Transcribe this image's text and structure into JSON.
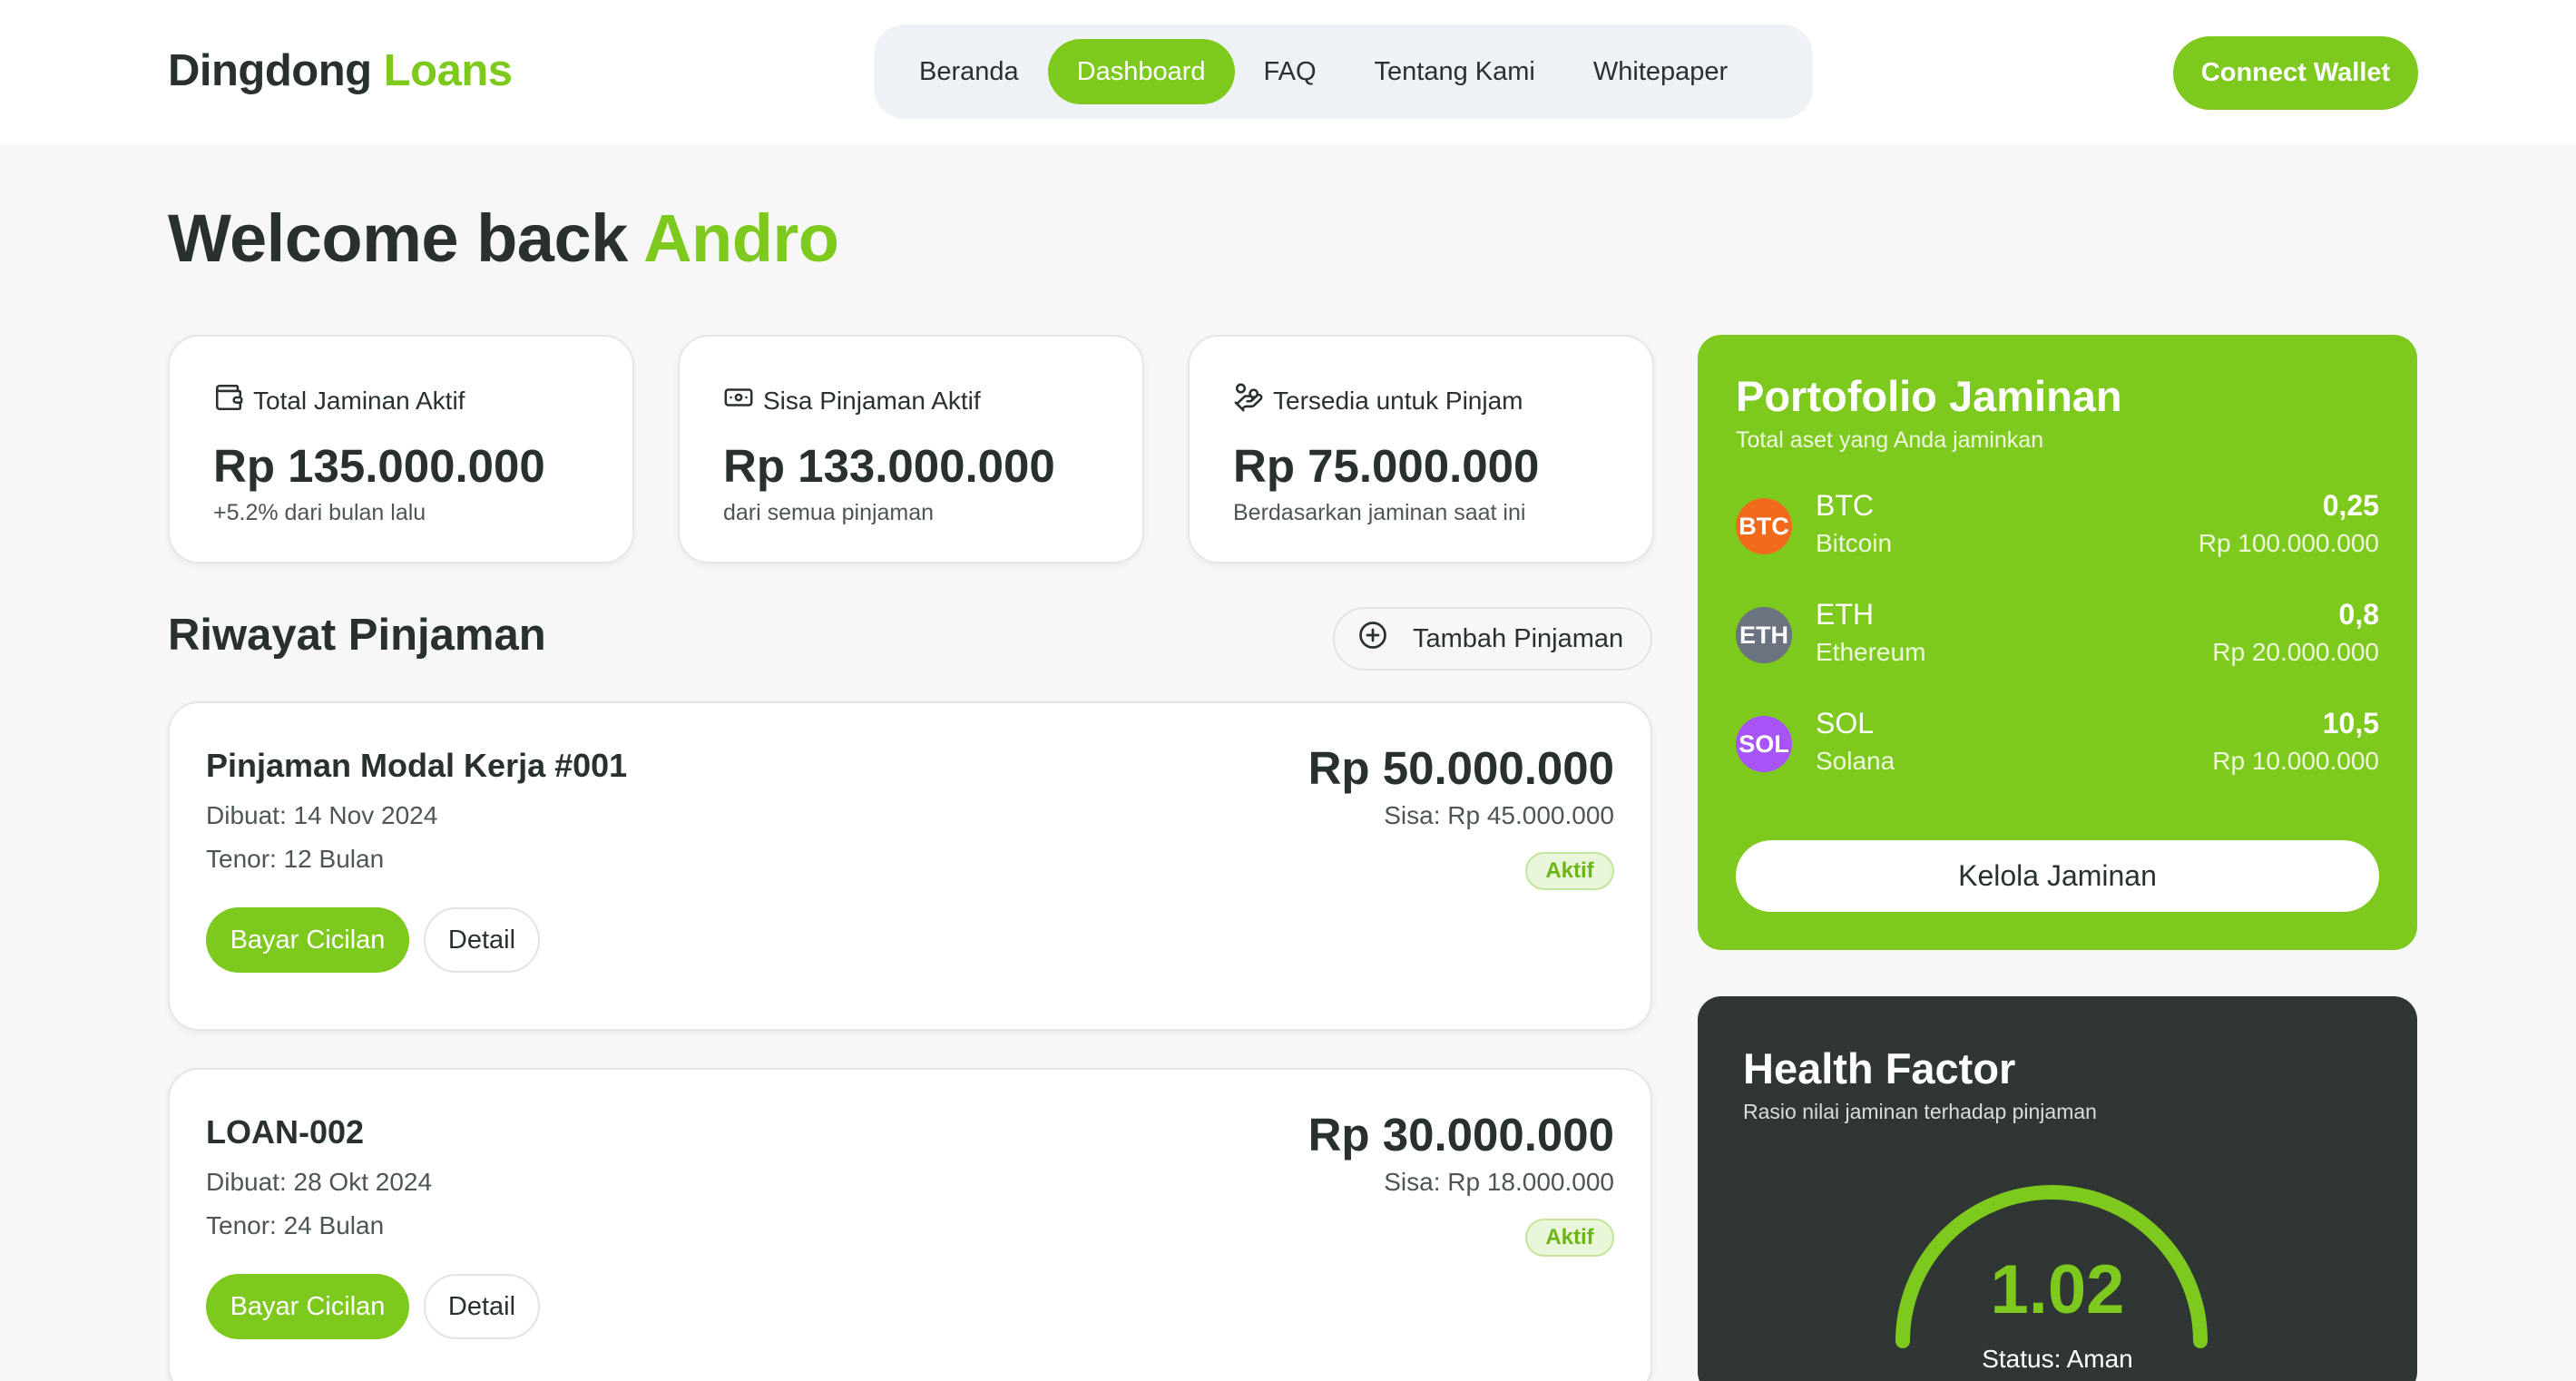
{
  "header": {
    "logo_main": "Dingdong",
    "logo_accent": "Loans",
    "nav": [
      "Beranda",
      "Dashboard",
      "FAQ",
      "Tentang Kami",
      "Whitepaper"
    ],
    "nav_active": "Dashboard",
    "connect_label": "Connect Wallet"
  },
  "welcome": {
    "prefix": "Welcome back",
    "name": "Andro"
  },
  "stats": [
    {
      "label": "Total Jaminan Aktif",
      "value": "Rp 135.000.000",
      "sub": "+5.2% dari bulan lalu",
      "icon": "wallet-icon"
    },
    {
      "label": "Sisa Pinjaman Aktif",
      "value": "Rp 133.000.000",
      "sub": "dari semua pinjaman",
      "icon": "banknote-icon"
    },
    {
      "label": "Tersedia untuk Pinjam",
      "value": "Rp 75.000.000",
      "sub": "Berdasarkan jaminan saat ini",
      "icon": "hand-coins-icon"
    }
  ],
  "history": {
    "title": "Riwayat Pinjaman",
    "add_label": "Tambah Pinjaman",
    "loans": [
      {
        "title": "Pinjaman Modal Kerja #001",
        "created": "Dibuat: 14 Nov 2024",
        "tenor": "Tenor: 12 Bulan",
        "amount": "Rp 50.000.000",
        "remaining": "Sisa: Rp 45.000.000",
        "status": "Aktif",
        "pay_label": "Bayar Cicilan",
        "detail_label": "Detail"
      },
      {
        "title": "LOAN-002",
        "created": "Dibuat: 28 Okt 2024",
        "tenor": "Tenor: 24 Bulan",
        "amount": "Rp 30.000.000",
        "remaining": "Sisa: Rp 18.000.000",
        "status": "Aktif",
        "pay_label": "Bayar Cicilan",
        "detail_label": "Detail"
      }
    ]
  },
  "portfolio": {
    "title": "Portofolio Jaminan",
    "subtitle": "Total aset yang Anda jaminkan",
    "assets": [
      {
        "symbol": "BTC",
        "name": "Bitcoin",
        "qty": "0,25",
        "value": "Rp 100.000.000",
        "color": "#f26b1d"
      },
      {
        "symbol": "ETH",
        "name": "Ethereum",
        "qty": "0,8",
        "value": "Rp 20.000.000",
        "color": "#6b7280"
      },
      {
        "symbol": "SOL",
        "name": "Solana",
        "qty": "10,5",
        "value": "Rp 10.000.000",
        "color": "#a855f7"
      }
    ],
    "manage_label": "Kelola Jaminan"
  },
  "health": {
    "title": "Health Factor",
    "subtitle": "Rasio nilai jaminan terhadap pinjaman",
    "value": "1.02",
    "status": "Status: Aman"
  },
  "colors": {
    "accent": "#7ec91e",
    "dark": "#2f3633",
    "text": "#283130"
  }
}
